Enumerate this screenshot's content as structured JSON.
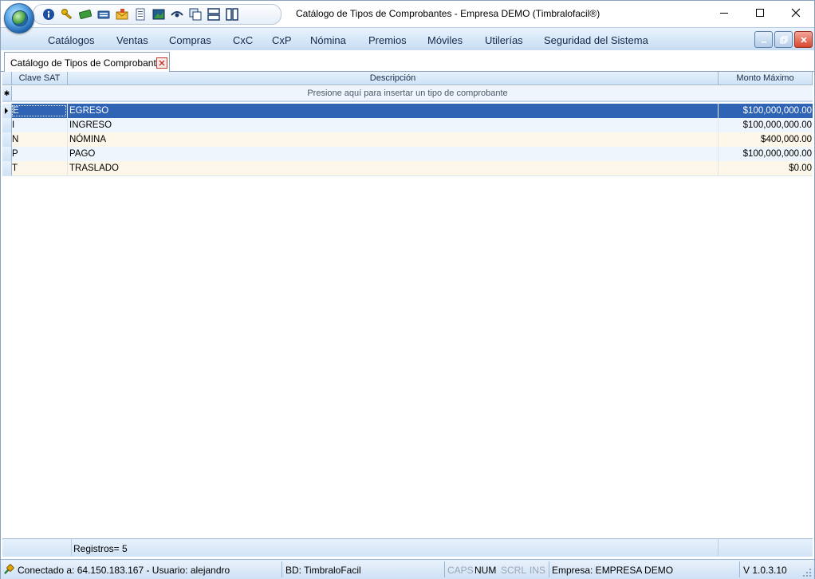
{
  "window": {
    "title": "Catálogo de Tipos de Comprobantes - Empresa DEMO (Timbralofacil®)"
  },
  "menu": [
    "Catálogos",
    "Ventas",
    "Compras",
    "CxC",
    "CxP",
    "Nómina",
    "Premios",
    "Móviles",
    "Utilerías",
    "Seguridad del Sistema"
  ],
  "tab": {
    "label": "Catálogo de Tipos de Comprobantes"
  },
  "grid": {
    "columns": [
      "Clave SAT",
      "Descripción",
      "Monto Máximo"
    ],
    "new_row_prompt": "Presione aquí para insertar un tipo de comprobante",
    "rows": [
      {
        "clave": "E",
        "descripcion": "EGRESO",
        "monto": "$100,000,000.00"
      },
      {
        "clave": "I",
        "descripcion": "INGRESO",
        "monto": "$100,000,000.00"
      },
      {
        "clave": "N",
        "descripcion": "NÓMINA",
        "monto": "$400,000.00"
      },
      {
        "clave": "P",
        "descripcion": "PAGO",
        "monto": "$100,000,000.00"
      },
      {
        "clave": "T",
        "descripcion": "TRASLADO",
        "monto": "$0.00"
      }
    ],
    "record_count": "Registros= 5"
  },
  "statusbar": {
    "connection": "Conectado a: 64.150.183.167 - Usuario: alejandro",
    "database": "BD: TimbraloFacil",
    "caps": "CAPS",
    "num": "NUM",
    "scrl": "SCRL",
    "ins": "INS",
    "company": "Empresa: EMPRESA DEMO",
    "version": "V 1.0.3.10"
  },
  "colors": {
    "selection": "#2f63b4",
    "menu_text": "#15284b",
    "close_button": "#d8472f"
  },
  "icons": [
    "app-orb-icon",
    "info-icon",
    "key-icon",
    "money-icon",
    "keyboard-icon",
    "mail-icon",
    "document-icon",
    "image-icon",
    "eye-icon",
    "cascade-windows-icon",
    "tile-horizontal-icon",
    "tile-vertical-icon"
  ]
}
